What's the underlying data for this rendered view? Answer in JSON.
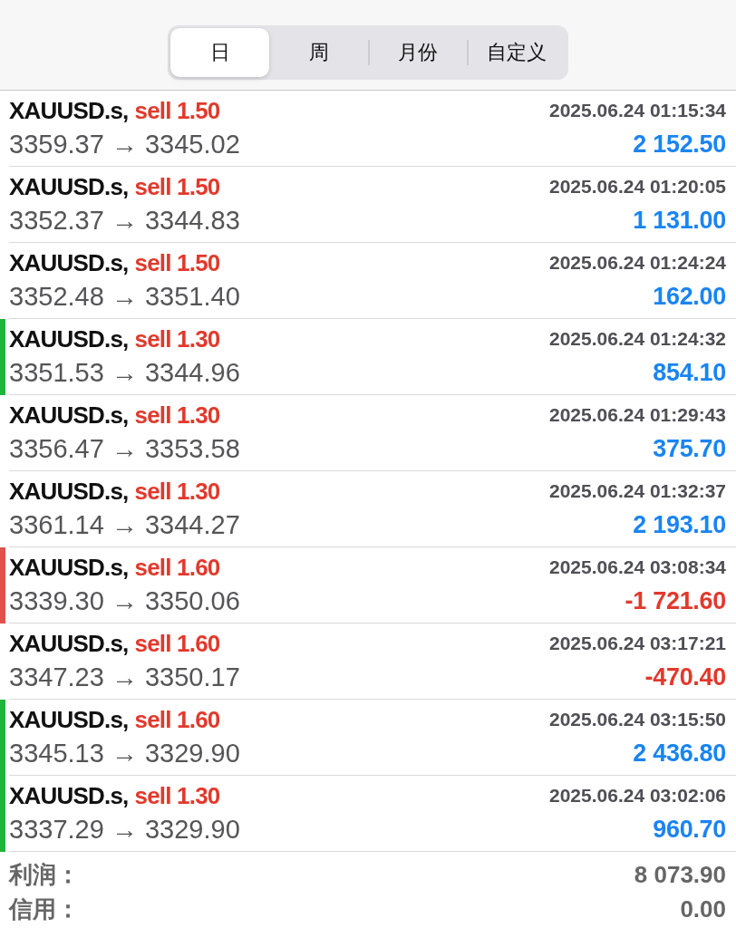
{
  "tabs": [
    {
      "label": "日",
      "selected": true
    },
    {
      "label": "周",
      "selected": false
    },
    {
      "label": "月份",
      "selected": false
    },
    {
      "label": "自定义",
      "selected": false
    }
  ],
  "trades": [
    {
      "symbol": "XAUUSD.s,",
      "order": "sell 1.50",
      "prices": "3359.37 → 3345.02",
      "time": "2025.06.24 01:15:34",
      "profit": "2 152.50",
      "loss": false
    },
    {
      "symbol": "XAUUSD.s,",
      "order": "sell 1.50",
      "prices": "3352.37 → 3344.83",
      "time": "2025.06.24 01:20:05",
      "profit": "1 131.00",
      "loss": false
    },
    {
      "symbol": "XAUUSD.s,",
      "order": "sell 1.50",
      "prices": "3352.48 → 3351.40",
      "time": "2025.06.24 01:24:24",
      "profit": "162.00",
      "loss": false
    },
    {
      "symbol": "XAUUSD.s,",
      "order": "sell 1.30",
      "prices": "3351.53 → 3344.96",
      "time": "2025.06.24 01:24:32",
      "profit": "854.10",
      "loss": false,
      "color": "#1fb53a"
    },
    {
      "symbol": "XAUUSD.s,",
      "order": "sell 1.30",
      "prices": "3356.47 → 3353.58",
      "time": "2025.06.24 01:29:43",
      "profit": "375.70",
      "loss": false
    },
    {
      "symbol": "XAUUSD.s,",
      "order": "sell 1.30",
      "prices": "3361.14 → 3344.27",
      "time": "2025.06.24 01:32:37",
      "profit": "2 193.10",
      "loss": false
    },
    {
      "symbol": "XAUUSD.s,",
      "order": "sell 1.60",
      "prices": "3339.30 → 3350.06",
      "time": "2025.06.24 03:08:34",
      "profit": "-1 721.60",
      "loss": true,
      "color": "#e0524c"
    },
    {
      "symbol": "XAUUSD.s,",
      "order": "sell 1.60",
      "prices": "3347.23 → 3350.17",
      "time": "2025.06.24 03:17:21",
      "profit": "-470.40",
      "loss": true
    },
    {
      "symbol": "XAUUSD.s,",
      "order": "sell 1.60",
      "prices": "3345.13 → 3329.90",
      "time": "2025.06.24 03:15:50",
      "profit": "2 436.80",
      "loss": false,
      "color": "#1fb53a"
    },
    {
      "symbol": "XAUUSD.s,",
      "order": "sell 1.30",
      "prices": "3337.29 → 3329.90",
      "time": "2025.06.24 03:02:06",
      "profit": "960.70",
      "loss": false,
      "color": "#1fb53a"
    }
  ],
  "summary": [
    {
      "label": "利润：",
      "value": "8 073.90"
    },
    {
      "label": "信用：",
      "value": "0.00"
    }
  ]
}
